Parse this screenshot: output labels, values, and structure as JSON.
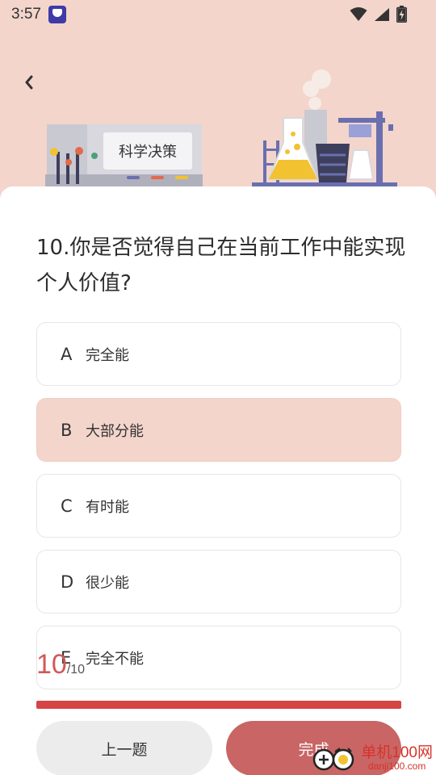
{
  "status": {
    "time": "3:57"
  },
  "header": {
    "sign_text": "科学决策"
  },
  "question": {
    "text": "10.你是否觉得自己在当前工作中能实现个人价值?"
  },
  "options": [
    {
      "letter": "A",
      "text": "完全能",
      "selected": false
    },
    {
      "letter": "B",
      "text": "大部分能",
      "selected": true
    },
    {
      "letter": "C",
      "text": "有时能",
      "selected": false
    },
    {
      "letter": "D",
      "text": "很少能",
      "selected": false
    },
    {
      "letter": "E",
      "text": "完全不能",
      "selected": false
    }
  ],
  "progress": {
    "current": "10",
    "total": "/10",
    "fraction": 1.0
  },
  "buttons": {
    "prev_label": "上一题",
    "done_label": "完成"
  },
  "watermark": {
    "main": "单机100网",
    "sub": "danji100.com"
  },
  "colors": {
    "accent": "#c96565",
    "header_bg": "#f3d5cb",
    "selected_option": "#f3d5cb",
    "progress": "#d64444"
  }
}
